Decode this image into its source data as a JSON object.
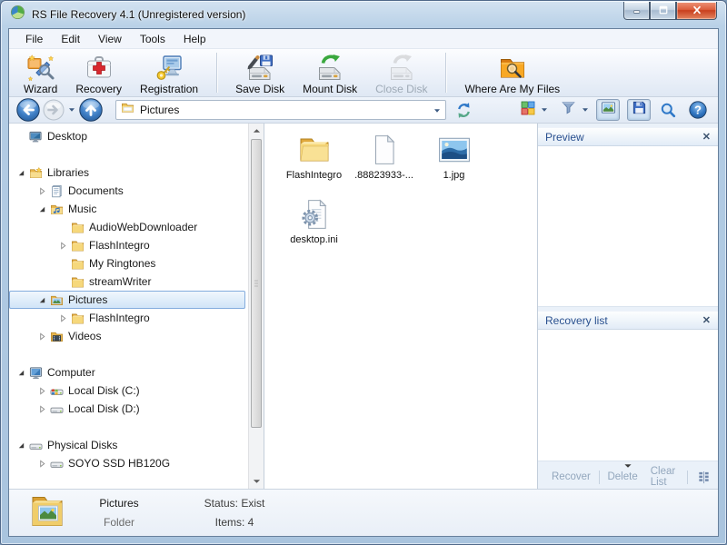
{
  "window": {
    "title": "RS File Recovery 4.1 (Unregistered version)"
  },
  "menu": {
    "items": [
      "File",
      "Edit",
      "View",
      "Tools",
      "Help"
    ]
  },
  "toolbar": {
    "groups": [
      [
        {
          "label": "Wizard",
          "icon": "wizard-icon",
          "enabled": true
        },
        {
          "label": "Recovery",
          "icon": "recovery-icon",
          "enabled": true
        },
        {
          "label": "Registration",
          "icon": "registration-icon",
          "enabled": true
        }
      ],
      [
        {
          "label": "Save Disk",
          "icon": "save-disk-icon",
          "enabled": true
        },
        {
          "label": "Mount Disk",
          "icon": "mount-disk-icon",
          "enabled": true
        },
        {
          "label": "Close Disk",
          "icon": "close-disk-icon",
          "enabled": false
        }
      ],
      [
        {
          "label": "Where Are My Files",
          "icon": "where-are-my-files-icon",
          "enabled": true
        }
      ]
    ]
  },
  "navbar": {
    "address": "Pictures"
  },
  "tree": {
    "items": [
      {
        "label": "Desktop",
        "icon": "desktop-icon",
        "level": 0,
        "expander": "none",
        "gap": false,
        "selected": false
      },
      {
        "label": "Libraries",
        "icon": "libraries-icon",
        "level": 0,
        "expander": "open",
        "gap": true,
        "selected": false
      },
      {
        "label": "Documents",
        "icon": "documents-icon",
        "level": 1,
        "expander": "closed",
        "gap": false,
        "selected": false
      },
      {
        "label": "Music",
        "icon": "music-icon",
        "level": 1,
        "expander": "open",
        "gap": false,
        "selected": false
      },
      {
        "label": "AudioWebDownloader",
        "icon": "folder-icon",
        "level": 2,
        "expander": "none",
        "gap": false,
        "selected": false
      },
      {
        "label": "FlashIntegro",
        "icon": "folder-icon",
        "level": 2,
        "expander": "closed",
        "gap": false,
        "selected": false
      },
      {
        "label": "My Ringtones",
        "icon": "folder-icon",
        "level": 2,
        "expander": "none",
        "gap": false,
        "selected": false
      },
      {
        "label": "streamWriter",
        "icon": "folder-icon",
        "level": 2,
        "expander": "none",
        "gap": false,
        "selected": false
      },
      {
        "label": "Pictures",
        "icon": "pictures-icon",
        "level": 1,
        "expander": "open",
        "gap": false,
        "selected": true
      },
      {
        "label": "FlashIntegro",
        "icon": "folder-icon",
        "level": 2,
        "expander": "closed",
        "gap": false,
        "selected": false
      },
      {
        "label": "Videos",
        "icon": "videos-icon",
        "level": 1,
        "expander": "closed",
        "gap": false,
        "selected": false
      },
      {
        "label": "Computer",
        "icon": "computer-icon",
        "level": 0,
        "expander": "open",
        "gap": true,
        "selected": false
      },
      {
        "label": "Local Disk (C:)",
        "icon": "disk-c-icon",
        "level": 1,
        "expander": "closed",
        "gap": false,
        "selected": false
      },
      {
        "label": "Local Disk (D:)",
        "icon": "disk-icon",
        "level": 1,
        "expander": "closed",
        "gap": false,
        "selected": false
      },
      {
        "label": "Physical Disks",
        "icon": "disk-icon",
        "level": 0,
        "expander": "open",
        "gap": true,
        "selected": false
      },
      {
        "label": "SOYO SSD HB120G",
        "icon": "disk-icon",
        "level": 1,
        "expander": "closed",
        "gap": false,
        "selected": false
      }
    ]
  },
  "main": {
    "files": [
      {
        "name": "FlashIntegro",
        "icon": "folder-large-icon"
      },
      {
        "name": ".88823933-...",
        "icon": "file-large-icon"
      },
      {
        "name": "1.jpg",
        "icon": "image-large-icon"
      },
      {
        "name": "desktop.ini",
        "icon": "ini-large-icon"
      }
    ]
  },
  "preview_panel": {
    "title": "Preview",
    "close_label": "✕"
  },
  "recovery_panel": {
    "title": "Recovery list",
    "close_label": "✕",
    "actions": [
      "Recover",
      "Delete",
      "Clear List"
    ]
  },
  "statusbar": {
    "name": "Pictures",
    "kind": "Folder",
    "status": "Status: Exist",
    "items": "Items: 4"
  },
  "colors": {
    "accent_blue": "#2f74c0",
    "selection_border": "#84acdd",
    "selection_fill": "#cfe4f7",
    "folder_yellow": "#e9b64d",
    "close_button_red": "#c03212",
    "panel_bg": "#eaf1f9"
  }
}
